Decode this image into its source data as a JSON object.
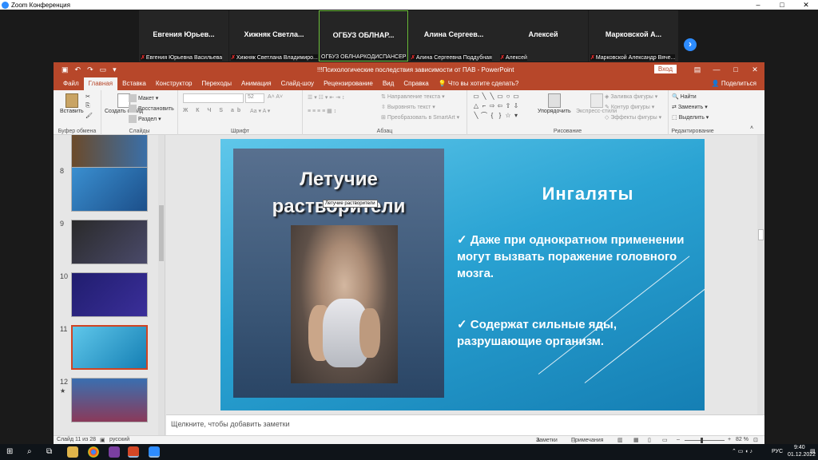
{
  "zoom": {
    "title": "Zoom Конференция",
    "controls": [
      "–",
      "□",
      "✕"
    ],
    "participants": [
      {
        "name": "Евгения Юрьев...",
        "label": "Евгения Юрьевна Васильева",
        "muted": true
      },
      {
        "name": "Хижняк Светла...",
        "label": "Хижняк Светлана Владимиро...",
        "muted": true
      },
      {
        "name": "ОГБУЗ ОБЛНАР...",
        "label": "ОГБУЗ ОБЛНАРКОДИСПАНСЕР",
        "muted": false
      },
      {
        "name": "Алина Сергеев...",
        "label": "Алина Сергеевна Поддубная",
        "muted": true
      },
      {
        "name": "Алексей",
        "label": "Алексей",
        "muted": true
      },
      {
        "name": "Марковской А...",
        "label": "Марковской Александр Вяче...",
        "muted": true
      }
    ],
    "next_arrow": "›"
  },
  "ppt": {
    "doc_title": "!!!Психологические последствия зависимости от ПАВ  -  PowerPoint",
    "signin": "Вход",
    "window_controls": [
      "—",
      "□",
      "✕"
    ],
    "tabs": [
      "Файл",
      "Главная",
      "Вставка",
      "Конструктор",
      "Переходы",
      "Анимация",
      "Слайд-шоу",
      "Рецензирование",
      "Вид",
      "Справка"
    ],
    "tell_me": "Что вы хотите сделать?",
    "share": "Поделиться",
    "ribbon": {
      "paste": "Вставить",
      "clipboard_group": "Буфер обмена",
      "new_slide": "Создать слайд",
      "layout": "Макет",
      "reset": "Восстановить",
      "section": "Раздел",
      "slides_group": "Слайды",
      "font_size": "52",
      "font_group": "Шрифт",
      "text_direction": "Направление текста",
      "align_text": "Выровнять текст",
      "convert_smartart": "Преобразовать в SmartArt",
      "paragraph_group": "Абзац",
      "arrange": "Упорядочить",
      "quick_styles": "Экспресс-стили",
      "shape_fill": "Заливка фигуры",
      "shape_outline": "Контур фигуры",
      "shape_effects": "Эффекты фигуры",
      "drawing_group": "Рисование",
      "find": "Найти",
      "replace": "Заменить",
      "select": "Выделить",
      "editing_group": "Редактирование"
    },
    "thumbnails": [
      {
        "num": "8"
      },
      {
        "num": "9"
      },
      {
        "num": "10"
      },
      {
        "num": "11"
      },
      {
        "num": "12",
        "star": "★"
      }
    ],
    "slide": {
      "image_title": "Летучие растворители",
      "tooltip": "Летучие растворители",
      "heading": "Ингаляты",
      "bullets": [
        "✓  Даже при однократном применении могут вызвать поражение головного мозга.",
        "✓   Содержат сильные яды, разрушающие организм."
      ]
    },
    "notes_placeholder": "Щелкните, чтобы добавить заметки",
    "status": {
      "slide_of": "Слайд 11 из 28",
      "language": "русский",
      "notes": "Заметки",
      "comments": "Примечания",
      "zoom": "82 %"
    }
  },
  "taskbar": {
    "lang": "РУС",
    "time": "9:40",
    "date": "01.12.2022"
  }
}
